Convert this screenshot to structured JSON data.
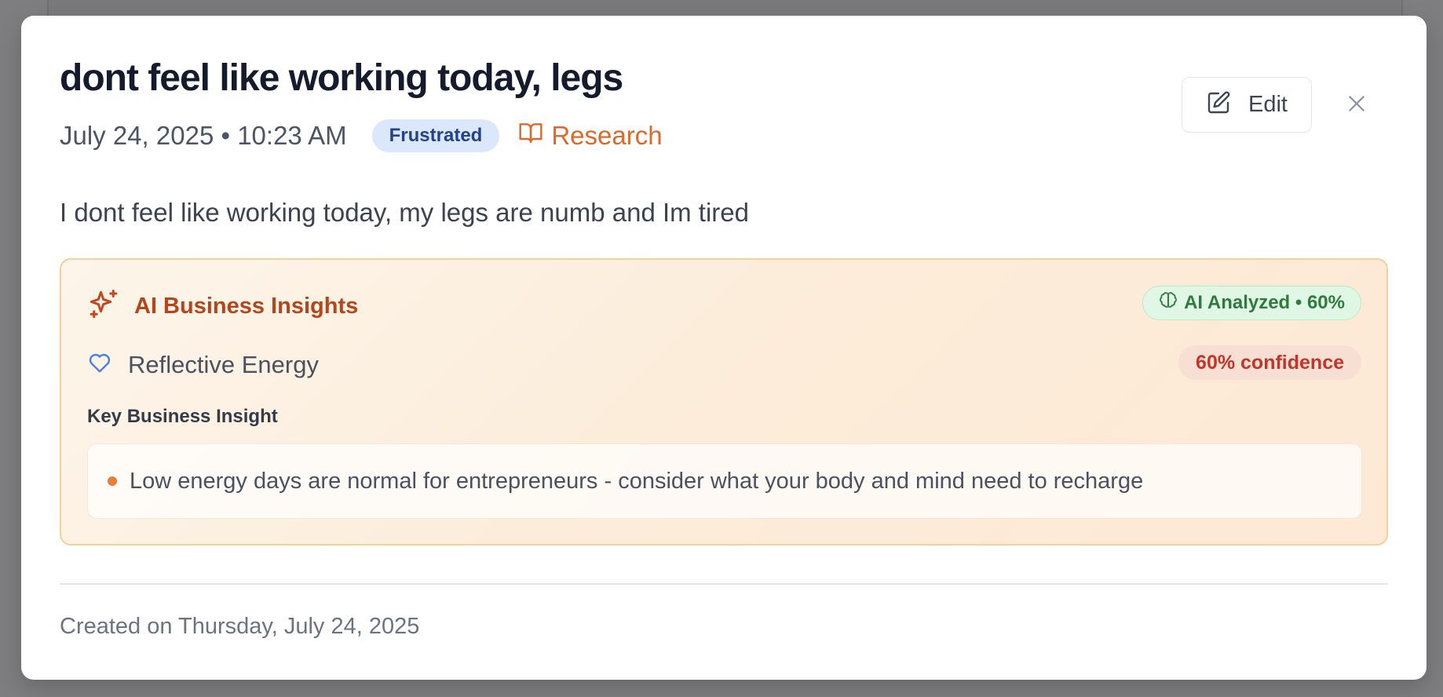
{
  "entry": {
    "title": "dont feel like working today, legs",
    "date": "July 24, 2025 • 10:23 AM",
    "mood_badge": "Frustrated",
    "category": "Research",
    "body": "I dont feel like working today, my legs are numb and Im tired"
  },
  "actions": {
    "edit_label": "Edit"
  },
  "icons": {
    "edit": "edit-pencil-icon",
    "close": "close-icon",
    "category": "book-open-icon",
    "insights": "sparkles-icon",
    "ai_badge": "brain-icon",
    "energy": "heart-icon"
  },
  "insights": {
    "title": "AI Business Insights",
    "ai_badge": "AI Analyzed • 60%",
    "energy_label": "Reflective Energy",
    "confidence": "60% confidence",
    "key_label": "Key Business Insight",
    "items": [
      "Low energy days are normal for entrepreneurs - consider what your body and mind need to recharge"
    ]
  },
  "footer": {
    "created": "Created on Thursday, July 24, 2025"
  },
  "colors": {
    "accent_orange": "#d96a2b",
    "insights_title": "#b4461e",
    "mood_badge_bg": "#dbe8fb",
    "ai_badge_green": "#2f7b3d",
    "confidence_red": "#c2352a",
    "heart_blue": "#4a7fe0"
  }
}
